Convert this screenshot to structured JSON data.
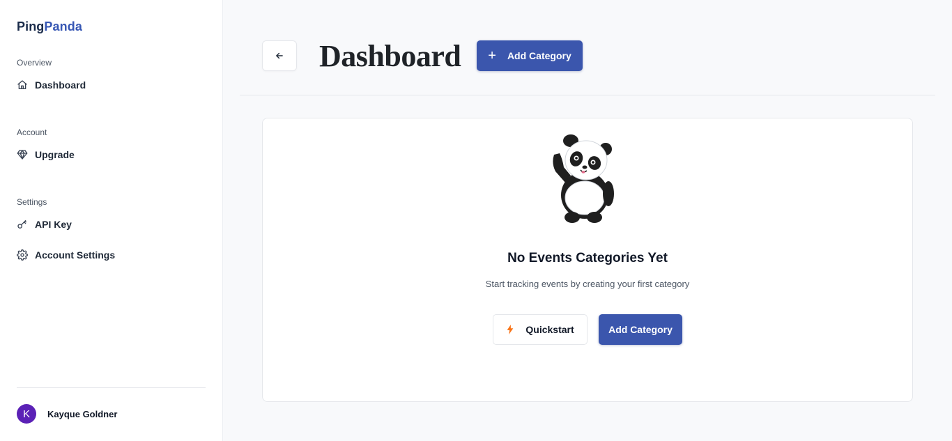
{
  "brand": {
    "part1": "Ping",
    "part2": "Panda"
  },
  "sidebar": {
    "sections": [
      {
        "label": "Overview",
        "items": [
          {
            "label": "Dashboard",
            "icon": "home-icon"
          }
        ]
      },
      {
        "label": "Account",
        "items": [
          {
            "label": "Upgrade",
            "icon": "gem-icon"
          }
        ]
      },
      {
        "label": "Settings",
        "items": [
          {
            "label": "API Key",
            "icon": "key-icon"
          },
          {
            "label": "Account Settings",
            "icon": "gear-icon"
          }
        ]
      }
    ],
    "user": {
      "initial": "K",
      "name": "Kayque Goldner"
    }
  },
  "header": {
    "title": "Dashboard",
    "add_button_label": "Add Category",
    "back_icon": "arrow-left-icon"
  },
  "empty_state": {
    "title": "No Events Categories Yet",
    "subtitle": "Start tracking events by creating your first category",
    "quickstart_label": "Quickstart",
    "add_label": "Add Category"
  },
  "colors": {
    "primary": "#3b56ad",
    "brand_accent": "#3757b4",
    "avatar": "#5b21b6",
    "bolt": "#f97316"
  }
}
